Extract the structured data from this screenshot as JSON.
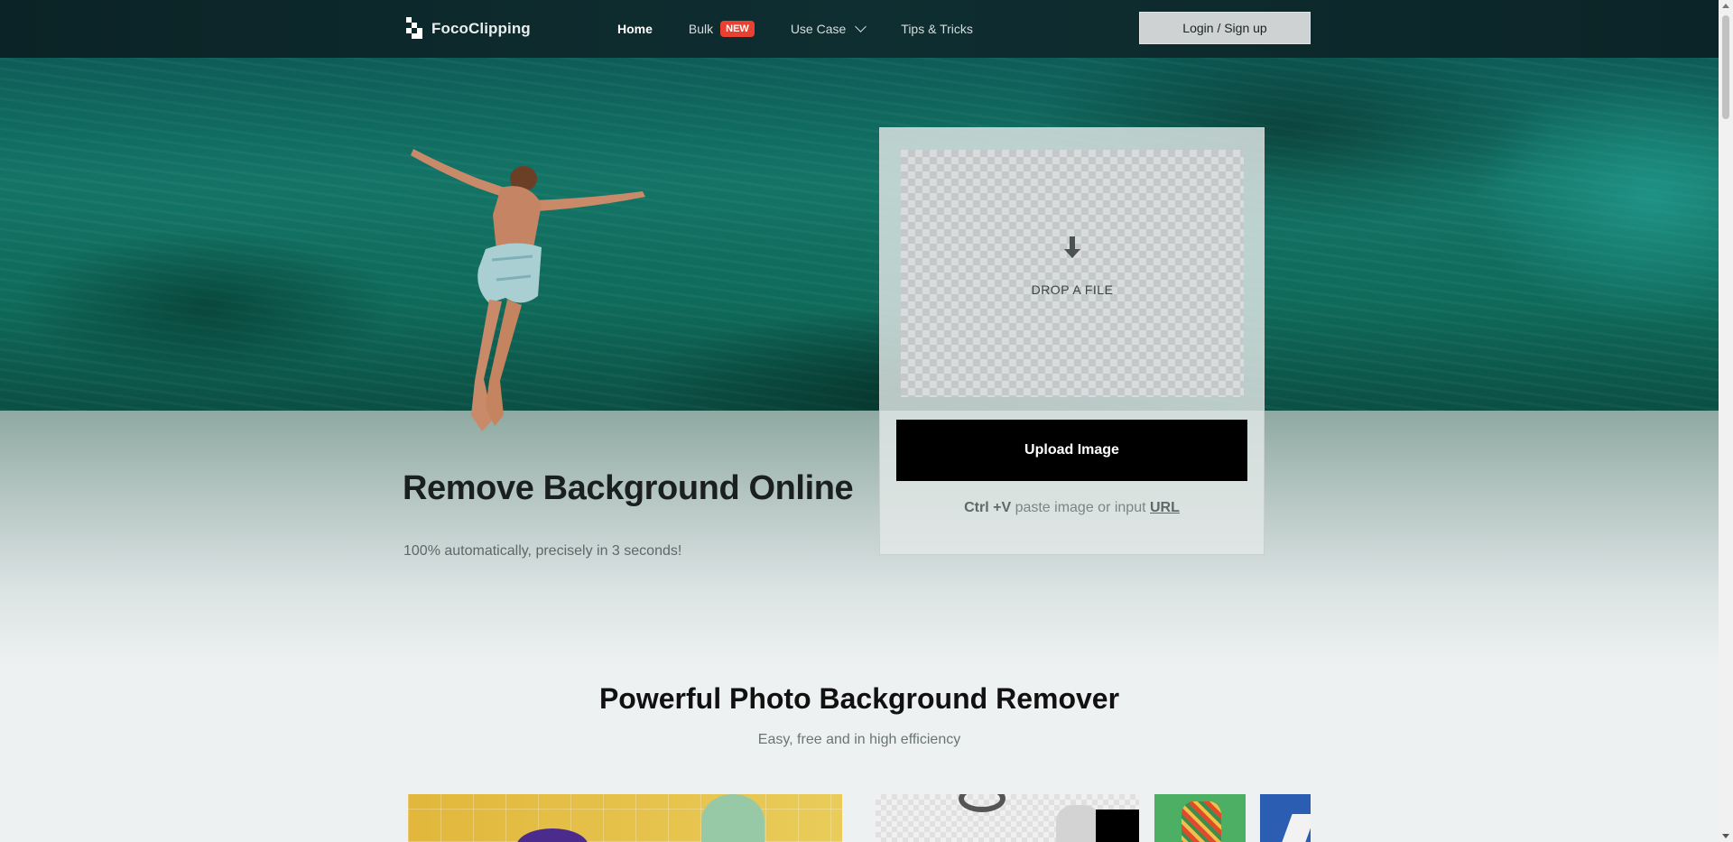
{
  "header": {
    "logo_text": "FocoClipping",
    "nav": {
      "home": "Home",
      "bulk": "Bulk",
      "bulk_badge": "NEW",
      "use_case": "Use Case",
      "tips": "Tips & Tricks"
    },
    "login_label": "Login / Sign up"
  },
  "hero": {
    "title": "Remove Background Online",
    "subtitle": "100% automatically, precisely in 3 seconds!"
  },
  "upload": {
    "drop_label": "DROP A FILE",
    "button_label": "Upload Image",
    "paste_shortcut": "Ctrl +V",
    "paste_text": "paste image or input",
    "url_link": "URL"
  },
  "section": {
    "title": "Powerful Photo Background Remover",
    "subtitle": "Easy, free and in high efficiency"
  },
  "icons": {
    "logo": "pixel-logo-icon",
    "use_case_dropdown": "chevron-down-icon",
    "drop": "arrow-down-icon"
  },
  "colors": {
    "topbar": "#0f2e31",
    "badge": "#e8412f",
    "upload_button": "#000000",
    "login_button": "#cfd2d2"
  }
}
